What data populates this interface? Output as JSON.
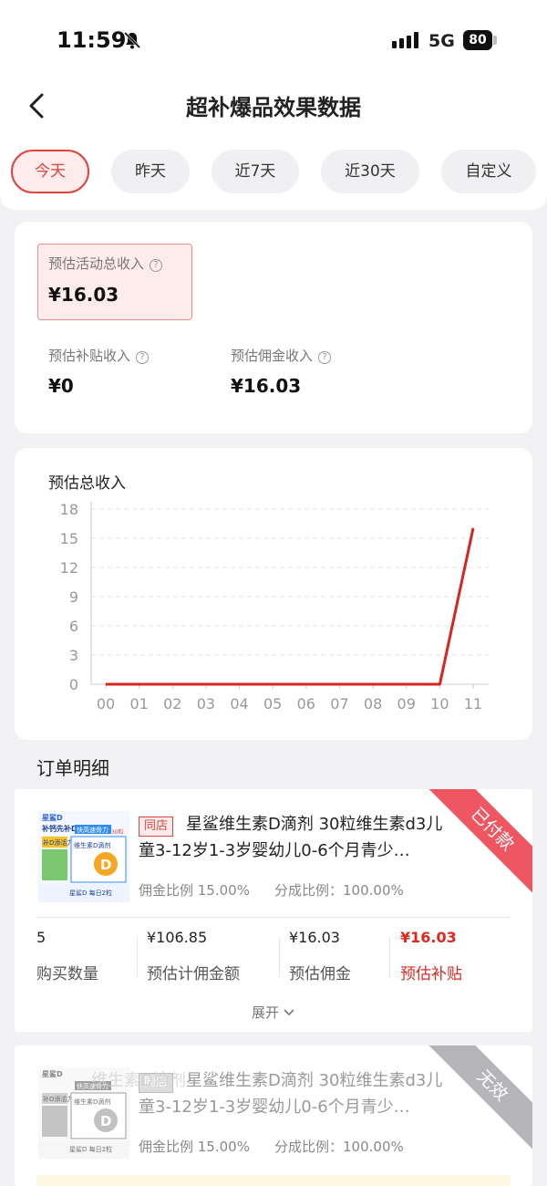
{
  "status": {
    "time": "11:59",
    "network": "5G",
    "battery": "80"
  },
  "header": {
    "title": "超补爆品效果数据"
  },
  "tabs": [
    {
      "label": "今天",
      "active": true
    },
    {
      "label": "昨天",
      "active": false
    },
    {
      "label": "近7天",
      "active": false
    },
    {
      "label": "近30天",
      "active": false
    },
    {
      "label": "自定义",
      "active": false
    }
  ],
  "summary": {
    "total_label": "预估活动总收入",
    "total_value": "¥16.03",
    "subsidy_label": "预估补贴收入",
    "subsidy_value": "¥0",
    "commission_label": "预估佣金收入",
    "commission_value": "¥16.03"
  },
  "chart_data": {
    "type": "line",
    "title": "预估总收入",
    "categories": [
      "00",
      "01",
      "02",
      "03",
      "04",
      "05",
      "06",
      "07",
      "08",
      "09",
      "10",
      "11"
    ],
    "values": [
      0,
      0,
      0,
      0,
      0,
      0,
      0,
      0,
      0,
      0,
      0,
      16.03
    ],
    "yticks": [
      0,
      3,
      6,
      9,
      12,
      15,
      18
    ],
    "ylim": [
      0,
      18
    ],
    "grid": true,
    "line_color": "#d9251c"
  },
  "orders_title": "订单明细",
  "orders": [
    {
      "shop_tag": "同店",
      "title": "星鲨维生素D滴剂 30粒维生素d3儿童3-12岁1-3岁婴幼儿0-6个月青少…",
      "commission_rate": "佣金比例 15.00%",
      "share_rate": "分成比例：100.00%",
      "status": "已付款",
      "qty_value": "5",
      "qty_label": "购买数量",
      "base_value": "¥106.85",
      "base_label": "预估计佣金额",
      "comm_value": "¥16.03",
      "comm_label": "预估佣金",
      "sub_value": "¥16.03",
      "sub_label": "预估补贴",
      "expand": "展开"
    },
    {
      "shop_tag": "同店",
      "title": "星鲨维生素D滴剂 30粒维生素d3儿童3-12岁1-3岁婴幼儿0-6个月青少…",
      "commission_rate": "佣金比例 15.00%",
      "share_rate": "分成比例：100.00%",
      "status": "无效"
    }
  ],
  "product_image": {
    "brand": "星鲨D",
    "slogan": "补钙先补D",
    "badge": "快高速骨力",
    "banner": "补D添活力",
    "name": "维生素D滴剂",
    "count": "30粒",
    "daily": "星鲨D 每日2粒"
  },
  "watermark": "维生素D滴剂"
}
